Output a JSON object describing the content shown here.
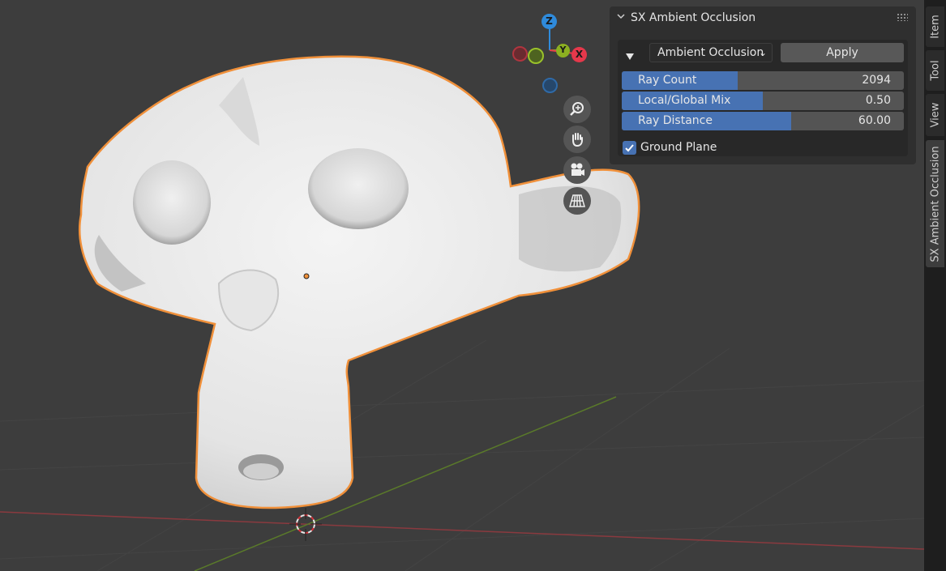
{
  "panel": {
    "title": "SX Ambient Occlusion",
    "dropdown_value": "Ambient Occlusion",
    "apply_label": "Apply",
    "sliders": [
      {
        "label": "Ray Count",
        "value": "2094",
        "fill": 0.41
      },
      {
        "label": "Local/Global Mix",
        "value": "0.50",
        "fill": 0.5
      },
      {
        "label": "Ray Distance",
        "value": "60.00",
        "fill": 0.6
      }
    ],
    "ground_plane": {
      "label": "Ground Plane",
      "checked": true
    }
  },
  "gizmo": {
    "z_label": "Z",
    "y_label": "Y",
    "x_label": "X"
  },
  "tabs": [
    "Item",
    "Tool",
    "View",
    "SX Ambient Occlusion"
  ],
  "active_tab": "SX Ambient Occlusion",
  "colors": {
    "accent": "#4772b3",
    "selection_outline": "#f0903a",
    "x_axis": "#e5384b",
    "y_axis": "#8cb021",
    "z_axis": "#2f8bdc"
  }
}
